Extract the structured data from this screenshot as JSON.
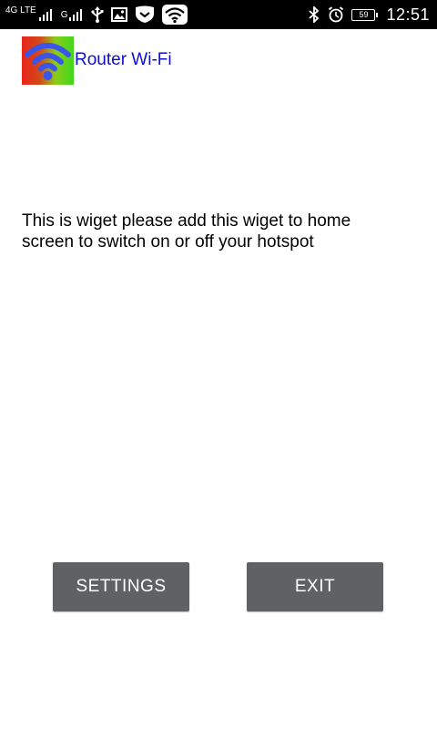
{
  "status_bar": {
    "network_type": "4G LTE",
    "sim2_indicator": "G",
    "icons": {
      "signal1": "signal-bars-icon",
      "signal2": "signal-bars-icon",
      "usb": "usb-icon",
      "image": "image-icon",
      "shield": "shield-icon",
      "wifi": "wifi-icon",
      "bluetooth": "bluetooth-icon",
      "alarm": "alarm-clock-icon",
      "battery": "battery-icon"
    },
    "battery_level": "59",
    "time": "12:51"
  },
  "app": {
    "logo_icon": "router-wifi-logo-icon",
    "title": "Router Wi-Fi"
  },
  "main": {
    "message": "This is wiget please add this wiget to home screen to switch on or off your hotspot"
  },
  "buttons": {
    "settings_label": "SETTINGS",
    "exit_label": "EXIT"
  },
  "colors": {
    "status_bar": "#000000",
    "title_text": "#1010c8",
    "button_bg": "#5f6264",
    "logo_wifi": "#3a55e8"
  }
}
